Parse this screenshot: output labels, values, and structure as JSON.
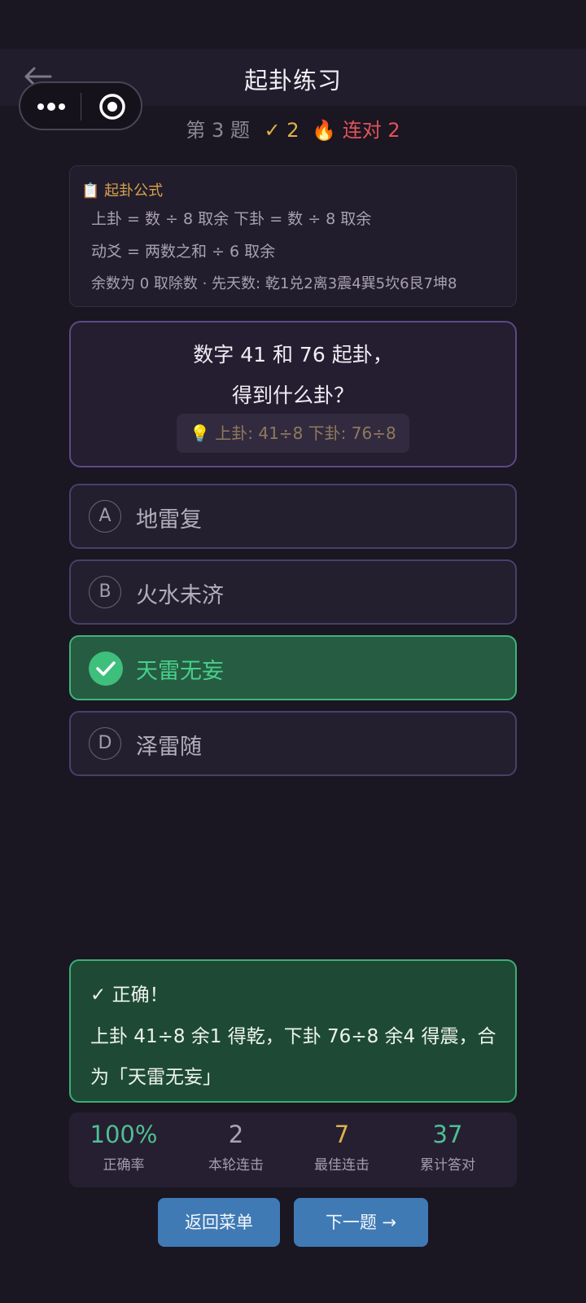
{
  "header": {
    "title": "起卦练习"
  },
  "progress": {
    "question_number": "第 3 题",
    "correct_count": "✓ 2",
    "streak": "连对 2"
  },
  "formula": {
    "title": "起卦公式",
    "lines": [
      "上卦 = 数 ÷ 8 取余    下卦 = 数 ÷ 8 取余",
      "动爻 = 两数之和 ÷ 6 取余",
      "余数为 0 取除数 · 先天数: 乾1兑2离3震4巽5坎6艮7坤8"
    ]
  },
  "question": {
    "line1": "数字 41 和 76 起卦，",
    "line2": "得到什么卦？",
    "hint": "上卦: 41÷8  下卦: 76÷8"
  },
  "options": [
    {
      "letter": "A",
      "text": "地雷复"
    },
    {
      "letter": "B",
      "text": "火水未济"
    },
    {
      "letter": "C",
      "text": "天雷无妄"
    },
    {
      "letter": "D",
      "text": "泽雷随"
    }
  ],
  "result": {
    "title": "✓ 正确！",
    "text": "上卦 41÷8 余1 得乾，下卦 76÷8 余4 得震，合为「天雷无妄」"
  },
  "stats": [
    {
      "value": "100%",
      "label": "正确率",
      "color": "#4fbf92"
    },
    {
      "value": "2",
      "label": "本轮连击",
      "color": "#a9a4b1"
    },
    {
      "value": "7",
      "label": "最佳连击",
      "color": "#e0b14a"
    },
    {
      "value": "37",
      "label": "累计答对",
      "color": "#4fbf92"
    }
  ],
  "buttons": {
    "menu": "返回菜单",
    "next": "下一题 →"
  }
}
